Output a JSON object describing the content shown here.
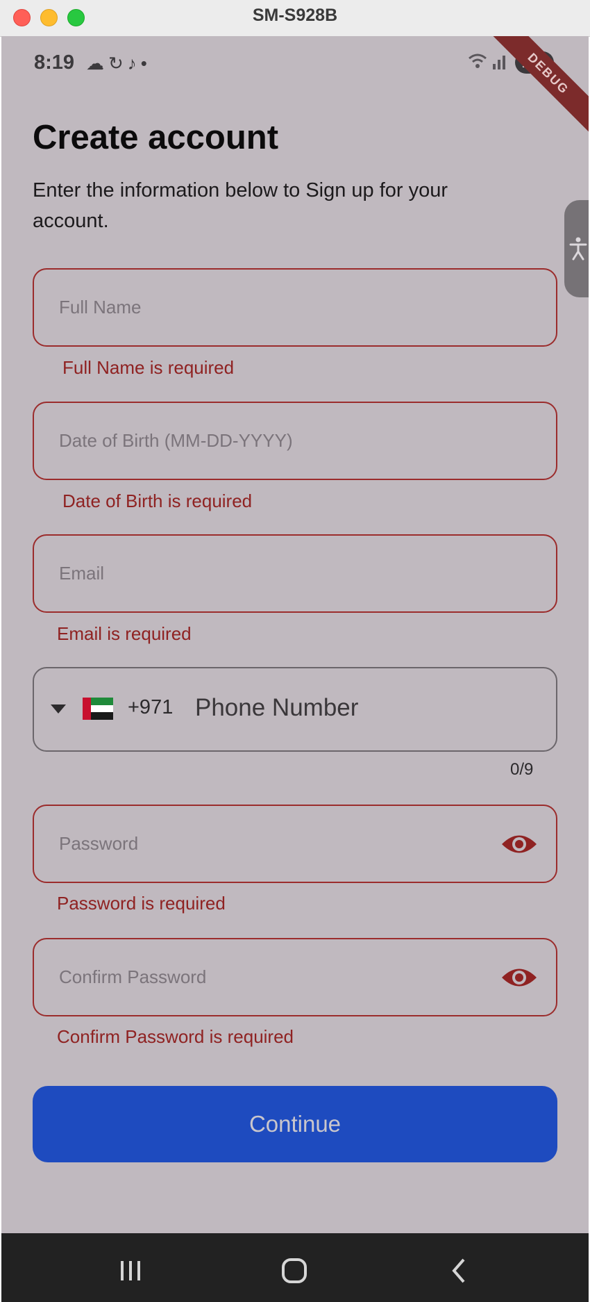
{
  "window": {
    "title": "SM-S928B"
  },
  "status_bar": {
    "time": "8:19",
    "battery": "100",
    "debug_banner": "DEBUG"
  },
  "page": {
    "title": "Create account",
    "subtitle": "Enter the information below to Sign up for your account."
  },
  "fields": {
    "full_name": {
      "placeholder": "Full Name",
      "error": "Full Name is required"
    },
    "dob": {
      "placeholder": "Date of Birth (MM-DD-YYYY)",
      "error": "Date of Birth is required"
    },
    "email": {
      "placeholder": "Email",
      "error": "Email is required"
    },
    "phone": {
      "country_code": "+971",
      "placeholder": "Phone Number",
      "counter": "0/9",
      "flag": "UAE flag"
    },
    "password": {
      "placeholder": "Password",
      "error": "Password is required"
    },
    "confirm_password": {
      "placeholder": "Confirm Password",
      "error": "Confirm Password is required"
    }
  },
  "actions": {
    "continue_label": "Continue"
  },
  "icons": {
    "eye": "eye-icon",
    "accessibility": "accessibility-icon",
    "nav_recents": "recents-icon",
    "nav_home": "home-icon",
    "nav_back": "back-icon"
  },
  "colors": {
    "error": "#9b2c2c",
    "primary_button": "#1e4bbf",
    "background": "#c0b9bf"
  }
}
